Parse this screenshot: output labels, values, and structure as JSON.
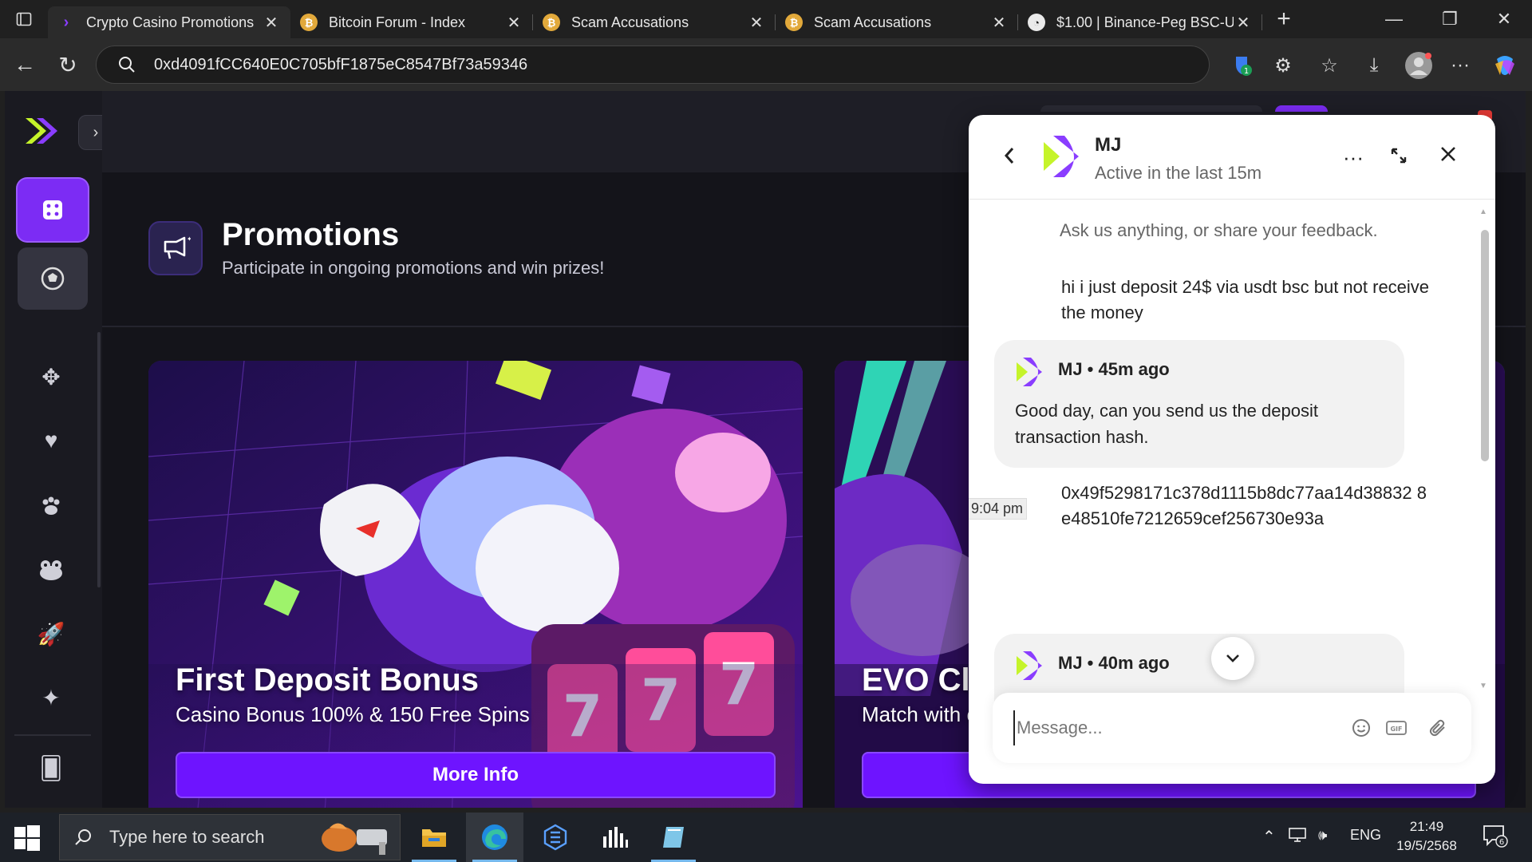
{
  "browser": {
    "tabs": [
      {
        "title": "Crypto Casino Promotions",
        "active": true,
        "icon": "purple-chevron-icon"
      },
      {
        "title": "Bitcoin Forum - Index",
        "active": false,
        "icon": "bitcoin-icon"
      },
      {
        "title": "Scam Accusations",
        "active": false,
        "icon": "bitcoin-icon"
      },
      {
        "title": "Scam Accusations",
        "active": false,
        "icon": "bitcoin-icon"
      },
      {
        "title": "$1.00 | Binance-Peg BSC-U",
        "active": false,
        "icon": "bscscan-icon"
      }
    ],
    "address": "0xd4091fCC640E0C705bfF1875eC8547Bf73a59346",
    "extension_badge": "1"
  },
  "site": {
    "promotions": {
      "title": "Promotions",
      "subtitle": "Participate in ongoing promotions and win prizes!"
    },
    "cards": [
      {
        "title": "First Deposit Bonus",
        "subtitle": "Casino Bonus 100% & 150 Free Spins",
        "button": "More Info"
      },
      {
        "title": "EVO Clas",
        "subtitle": "Match with c",
        "button": ""
      }
    ],
    "sidebar_icons": [
      "casino-icon",
      "sports-icon",
      "cards-icon",
      "heart-icon",
      "paw-icon",
      "frog-icon",
      "rocket-icon",
      "sparkle-icon",
      "playing-cards-icon"
    ],
    "accent_color": "#7c2cf4"
  },
  "chat": {
    "agent_name": "MJ",
    "agent_status": "Active in the last 15m",
    "intro": "Ask us anything, or share your feedback.",
    "messages": [
      {
        "from": "user",
        "text": "hi i just deposit 24$ via usdt bsc but not receive the money"
      },
      {
        "from": "agent",
        "meta": "MJ • 45m ago",
        "text": "Good day, can you send us the deposit transaction hash."
      },
      {
        "from": "user",
        "text": "0x49f5298171c378d1115b8dc77aa14d38832 8e48510fe7212659cef256730e93a"
      },
      {
        "from": "agent",
        "meta": "MJ • 40m ago",
        "text": ""
      }
    ],
    "time_tooltip": "9:04 pm",
    "input_placeholder": "Message..."
  },
  "taskbar": {
    "search_placeholder": "Type here to search",
    "language": "ENG",
    "time": "21:49",
    "date": "19/5/2568",
    "notifications": "6"
  }
}
